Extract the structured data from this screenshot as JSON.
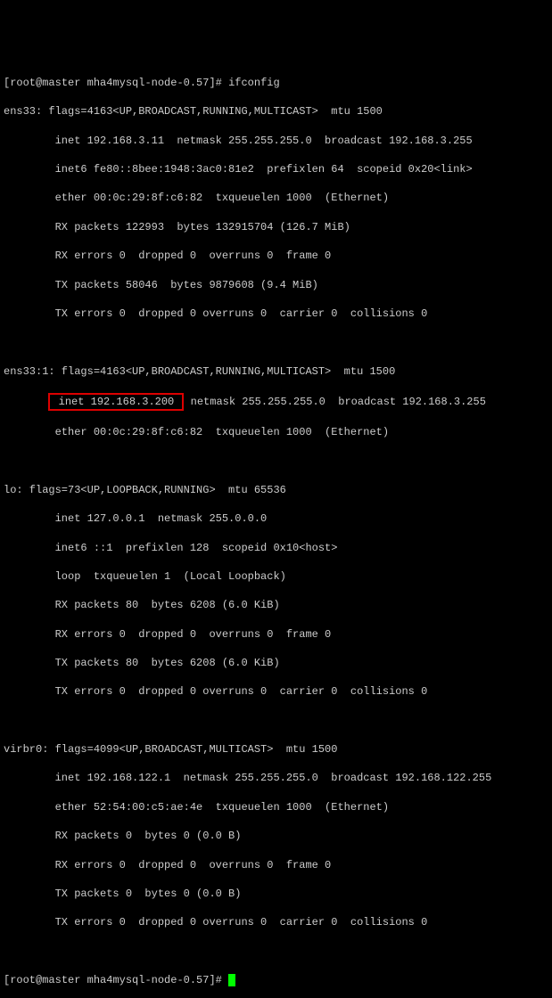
{
  "prompt": {
    "user": "root",
    "at": "@",
    "host": "master",
    "path": "mha4mysql-node-0.57",
    "suffix": "]#"
  },
  "command1": "ifconfig",
  "ens33": {
    "header": "ens33: flags=4163<UP,BROADCAST,RUNNING,MULTICAST>  mtu 1500",
    "inet": "        inet 192.168.3.11  netmask 255.255.255.0  broadcast 192.168.3.255",
    "inet6": "        inet6 fe80::8bee:1948:3ac0:81e2  prefixlen 64  scopeid 0x20<link>",
    "ether": "        ether 00:0c:29:8f:c6:82  txqueuelen 1000  (Ethernet)",
    "rx_packets": "        RX packets 122993  bytes 132915704 (126.7 MiB)",
    "rx_errors": "        RX errors 0  dropped 0  overruns 0  frame 0",
    "tx_packets": "        TX packets 58046  bytes 9879608 (9.4 MiB)",
    "tx_errors": "        TX errors 0  dropped 0 overruns 0  carrier 0  collisions 0"
  },
  "ens33_1": {
    "header": "ens33:1: flags=4163<UP,BROADCAST,RUNNING,MULTICAST>  mtu 1500",
    "inet_prefix": "       ",
    "inet_highlight": " inet 192.168.3.200 ",
    "inet_suffix": " netmask 255.255.255.0  broadcast 192.168.3.255",
    "ether": "        ether 00:0c:29:8f:c6:82  txqueuelen 1000  (Ethernet)"
  },
  "lo": {
    "header": "lo: flags=73<UP,LOOPBACK,RUNNING>  mtu 65536",
    "inet": "        inet 127.0.0.1  netmask 255.0.0.0",
    "inet6": "        inet6 ::1  prefixlen 128  scopeid 0x10<host>",
    "loop": "        loop  txqueuelen 1  (Local Loopback)",
    "rx_packets": "        RX packets 80  bytes 6208 (6.0 KiB)",
    "rx_errors": "        RX errors 0  dropped 0  overruns 0  frame 0",
    "tx_packets": "        TX packets 80  bytes 6208 (6.0 KiB)",
    "tx_errors": "        TX errors 0  dropped 0 overruns 0  carrier 0  collisions 0"
  },
  "virbr0": {
    "header": "virbr0: flags=4099<UP,BROADCAST,MULTICAST>  mtu 1500",
    "inet": "        inet 192.168.122.1  netmask 255.255.255.0  broadcast 192.168.122.255",
    "ether": "        ether 52:54:00:c5:ae:4e  txqueuelen 1000  (Ethernet)",
    "rx_packets": "        RX packets 0  bytes 0 (0.0 B)",
    "rx_errors": "        RX errors 0  dropped 0  overruns 0  frame 0",
    "tx_packets": "        TX packets 0  bytes 0 (0.0 B)",
    "tx_errors": "        TX errors 0  dropped 0 overruns 0  carrier 0  collisions 0"
  }
}
